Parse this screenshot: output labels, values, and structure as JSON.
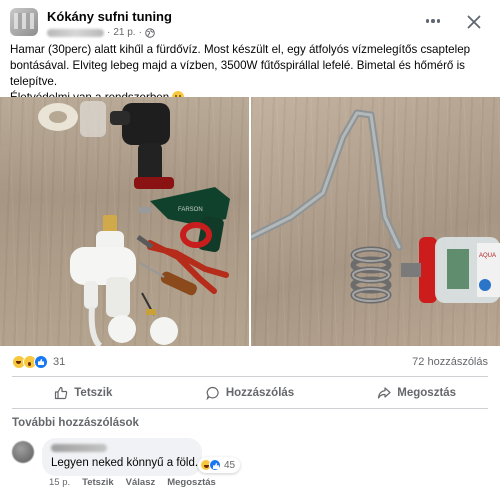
{
  "post": {
    "page_name": "Kókány sufni tuning",
    "time": "21 p.",
    "dot": "·",
    "text_lines": [
      "Hamar (30perc) alatt kihűl a fürdővíz. Most készült el, egy átfolyós vízmelegítős csaptelep",
      "bontásával. Elviteg lebeg majd a vízben, 3500W fűtőspirállal lefelé. Bimetal és hőmérő is telepítve.",
      "Életvédelmi van a rendszerben"
    ],
    "emoji_icon": "smiling-face-emoji",
    "photo_left_label": "FARSON",
    "photo_right_label": "AQUA"
  },
  "stats": {
    "reaction_count": "31",
    "comment_count": "72 hozzászólás",
    "reaction_icons": [
      "haha-reaction-icon",
      "wow-reaction-icon",
      "like-reaction-icon"
    ]
  },
  "actions": {
    "like": "Tetszik",
    "comment": "Hozzászólás",
    "share": "Megosztás"
  },
  "comments": {
    "more_label": "További hozzászólások",
    "items": [
      {
        "text": "Legyen neked könnyű a föld...",
        "reaction_count": "45",
        "time": "15 p.",
        "like": "Tetszik",
        "reply": "Válasz",
        "share": "Megosztás"
      }
    ]
  },
  "colors": {
    "accent": "#1877f2",
    "secondary_text": "#65676b",
    "bubble": "#f0f2f5"
  }
}
